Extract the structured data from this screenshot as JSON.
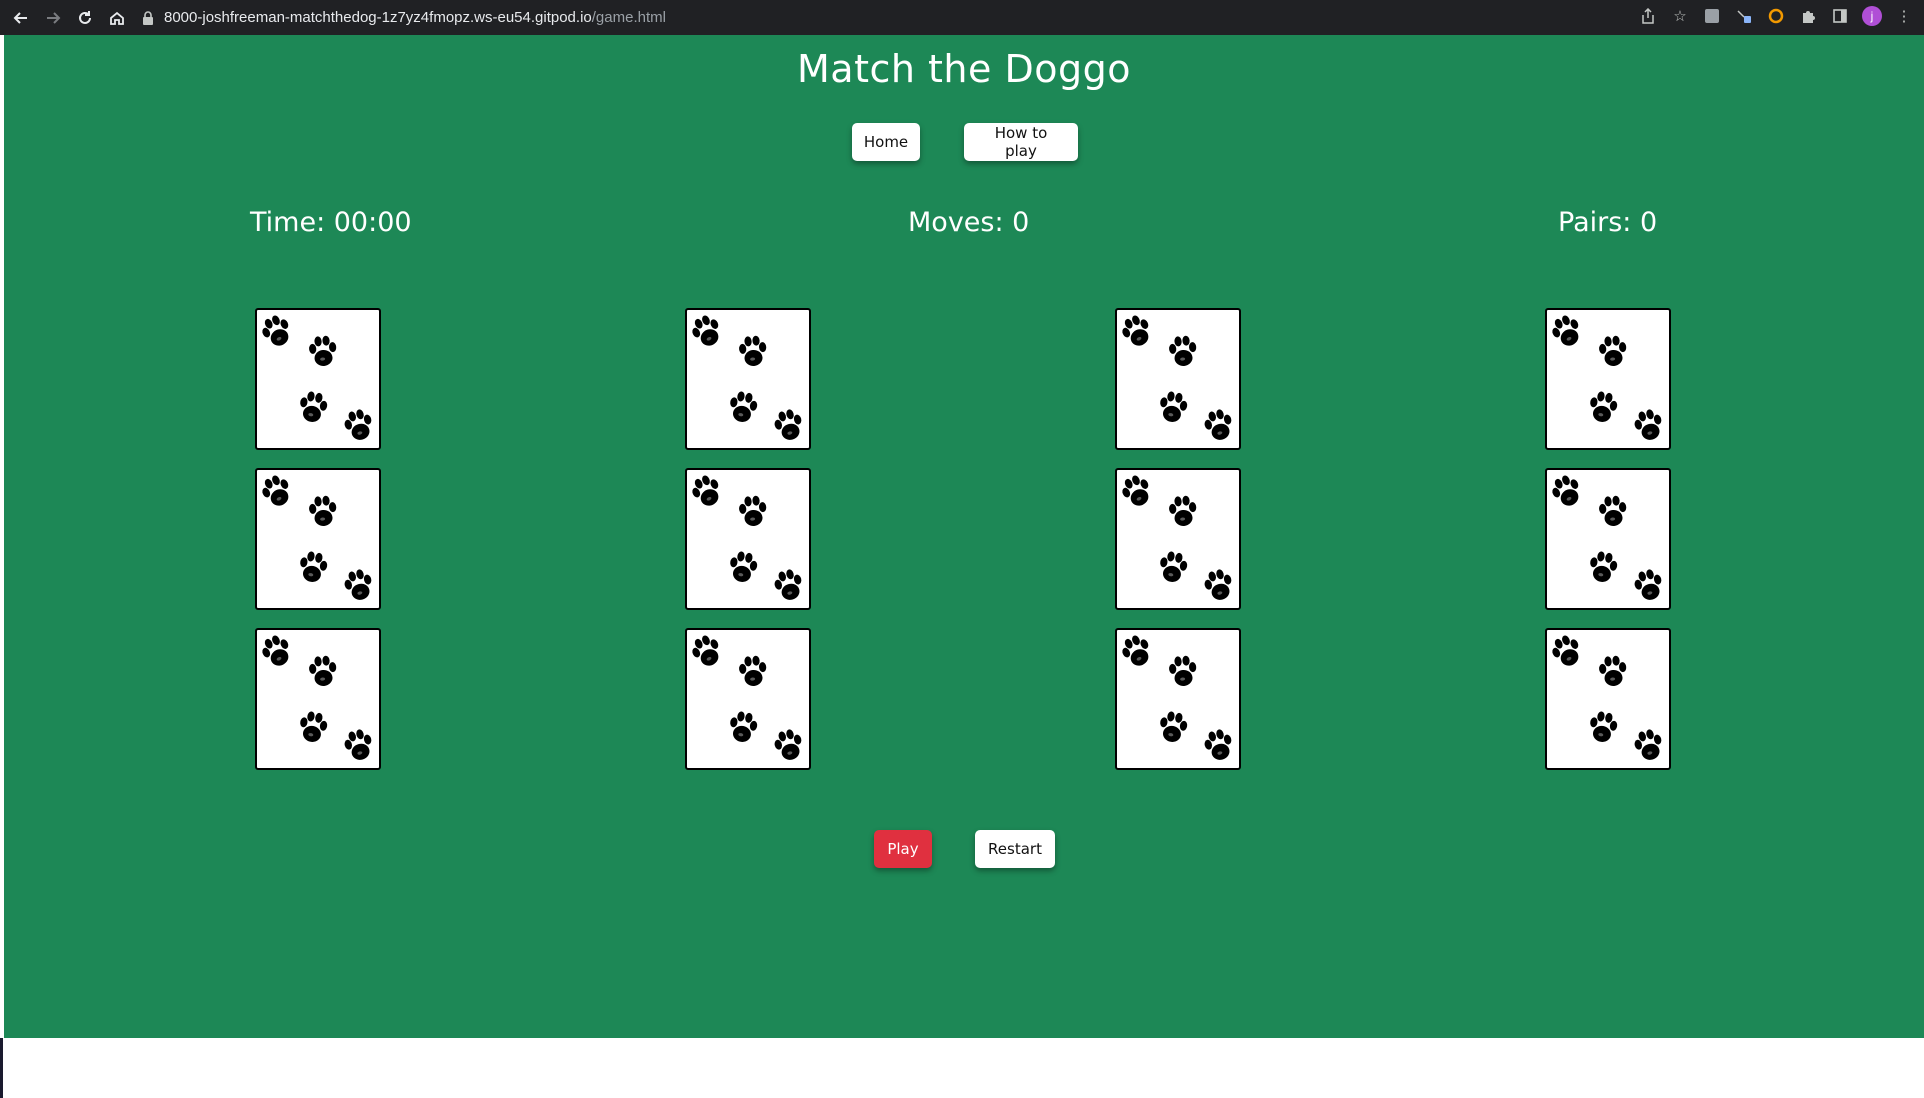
{
  "browser": {
    "url_host": "8000-joshfreeman-matchthedog-1z7yz4fmopz.ws-eu54.gitpod.io",
    "url_path": "/game.html",
    "avatar_letter": "j"
  },
  "page": {
    "title": "Match the Doggo",
    "nav": {
      "home_label": "Home",
      "how_to_play_label": "How to play"
    },
    "stats": {
      "time": "Time: 00:00",
      "moves": "Moves: 0",
      "pairs": "Pairs: 0"
    },
    "cards": {
      "rows": 3,
      "columns": 4,
      "face": "paw-prints-icon"
    },
    "controls": {
      "play_label": "Play",
      "restart_label": "Restart"
    }
  },
  "colors": {
    "background": "#1d8856",
    "play_button": "#e0303f",
    "card": "#ffffff"
  }
}
